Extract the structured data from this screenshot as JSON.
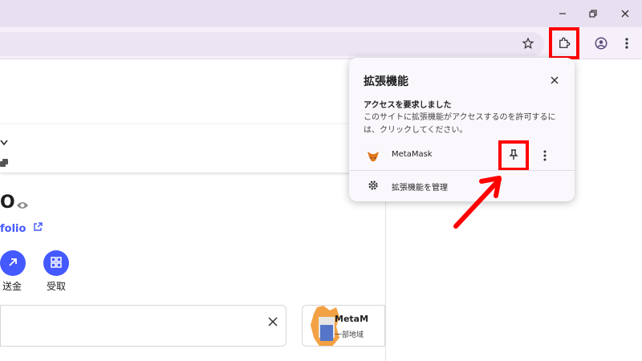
{
  "window": {
    "icons": [
      "minimize-icon",
      "restore-icon",
      "close-icon"
    ]
  },
  "toolbar": {
    "icons": [
      "star-icon",
      "extensions-icon",
      "profile-icon",
      "kebab-menu-icon"
    ]
  },
  "page": {
    "balance_fragment": "O",
    "portfolio_link": "folio",
    "actions": [
      {
        "label": "送金",
        "icon": "arrow-up-right-icon"
      },
      {
        "label": "受取",
        "icon": "qr-scan-icon"
      }
    ],
    "promo_title": "MetaM",
    "promo_sub": "一部地域"
  },
  "extensions_popup": {
    "title": "拡張機能",
    "request_title": "アクセスを要求しました",
    "request_description": "このサイトに拡張機能がアクセスするのを許可するには、クリックしてください。",
    "extension_name": "MetaMask",
    "manage_label": "拡張機能を管理"
  },
  "colors": {
    "accent": "#4459ff",
    "highlight": "#ff0000",
    "titlebar": "#e8e0f0"
  }
}
